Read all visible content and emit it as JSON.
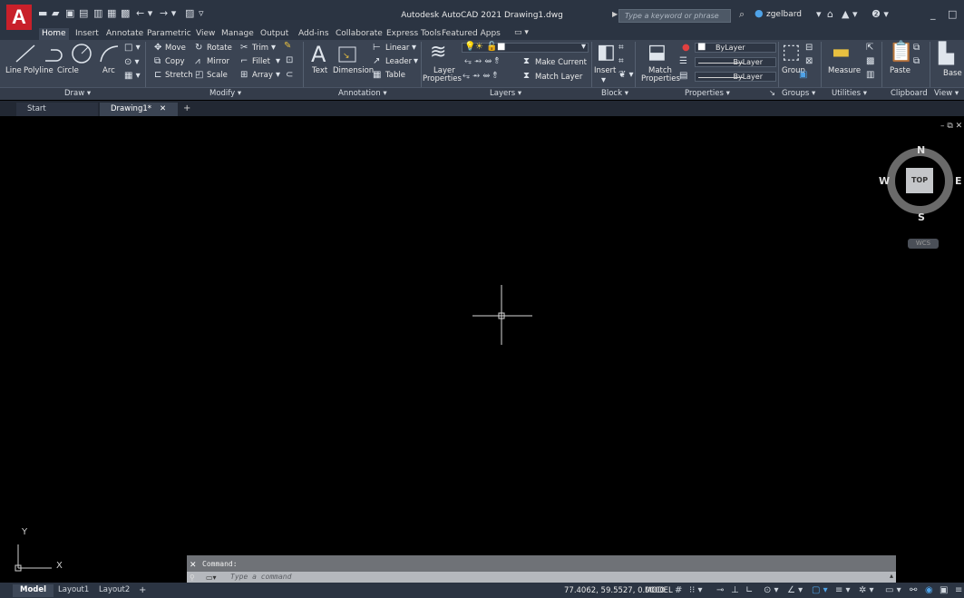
{
  "title_bar": {
    "title": "Autodesk AutoCAD 2021   Drawing1.dwg",
    "search_placeholder": "Type a keyword or phrase",
    "user_name": "zgelbard"
  },
  "app_logo": "A",
  "menu_tabs": [
    "Home",
    "Insert",
    "Annotate",
    "Parametric",
    "View",
    "Manage",
    "Output",
    "Add-ins",
    "Collaborate",
    "Express Tools",
    "Featured Apps"
  ],
  "ribbon": {
    "draw": {
      "line": "Line",
      "polyline": "Polyline",
      "circle": "Circle",
      "arc": "Arc",
      "panel": "Draw ▾"
    },
    "modify": {
      "move": "Move",
      "rotate": "Rotate",
      "trim": "Trim",
      "copy": "Copy",
      "mirror": "Mirror",
      "fillet": "Fillet",
      "stretch": "Stretch",
      "scale": "Scale",
      "array": "Array",
      "panel": "Modify ▾"
    },
    "annotation": {
      "text": "Text",
      "dimension": "Dimension",
      "linear": "Linear",
      "leader": "Leader",
      "table": "Table",
      "panel": "Annotation ▾"
    },
    "layers": {
      "layer_properties_1": "Layer",
      "layer_properties_2": "Properties",
      "current_layer": "0",
      "make_current": "Make Current",
      "match_layer": "Match Layer",
      "panel": "Layers ▾"
    },
    "block": {
      "insert": "Insert",
      "panel": "Block ▾"
    },
    "properties": {
      "match_1": "Match",
      "match_2": "Properties",
      "color": "ByLayer",
      "linetype": "ByLayer",
      "lineweight": "ByLayer",
      "panel": "Properties ▾"
    },
    "groups": {
      "group": "Group",
      "panel": "Groups ▾"
    },
    "utilities": {
      "measure": "Measure",
      "panel": "Utilities ▾"
    },
    "clipboard": {
      "paste": "Paste",
      "panel": "Clipboard"
    },
    "view": {
      "base": "Base",
      "panel": "View ▾"
    }
  },
  "doc_tabs": {
    "start": "Start",
    "drawing": "Drawing1*"
  },
  "viewcube": {
    "n": "N",
    "s": "S",
    "e": "E",
    "w": "W",
    "face": "TOP",
    "wcs": "WCS"
  },
  "ucs": {
    "x": "X",
    "y": "Y"
  },
  "command": {
    "history": "Command:",
    "placeholder": "Type a command"
  },
  "layout_tabs": [
    "Model",
    "Layout1",
    "Layout2"
  ],
  "status": {
    "coordinates": "77.4062, 59.5527, 0.0000",
    "space": "MODEL"
  }
}
